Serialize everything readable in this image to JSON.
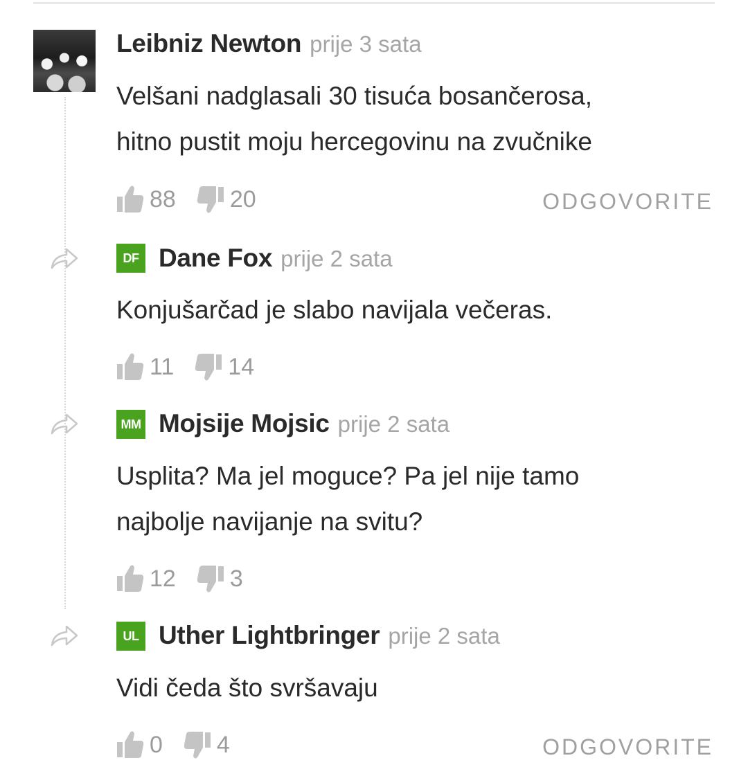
{
  "comments": [
    {
      "author": "Leibniz Newton",
      "time": "prije 3 sata",
      "avatar": "photo",
      "text_lines": [
        "Velšani nadglasali 30 tisuća bosančerosa,",
        "hitno pustit moju hercegovinu na zvučnike"
      ],
      "likes": "88",
      "dislikes": "20",
      "reply_label": "ODGOVORITE"
    },
    {
      "author": "Dane Fox",
      "time": "prije 2 sata",
      "initials": "DF",
      "text_lines": [
        "Konjušarčad je slabo navijala večeras."
      ],
      "likes": "11",
      "dislikes": "14"
    },
    {
      "author": "Mojsije Mojsic",
      "time": "prije 2 sata",
      "initials": "MM",
      "text_lines": [
        "Usplita? Ma jel moguce? Pa jel nije tamo",
        "najbolje navijanje na svitu?"
      ],
      "likes": "12",
      "dislikes": "3"
    },
    {
      "author": "Uther Lightbringer",
      "time": "prije 2 sata",
      "initials": "UL",
      "text_lines": [
        "Vidi čeda što svršavaju"
      ],
      "likes": "0",
      "dislikes": "4",
      "reply_label": "ODGOVORITE"
    }
  ],
  "colors": {
    "avatar_green": "#4aa31e",
    "muted_text": "#a5a5a5",
    "icon_gray": "#c4c4c4"
  },
  "icons": {
    "like": "thumbs-up-icon",
    "dislike": "thumbs-down-icon",
    "reply_indicator": "share-arrow-icon"
  }
}
